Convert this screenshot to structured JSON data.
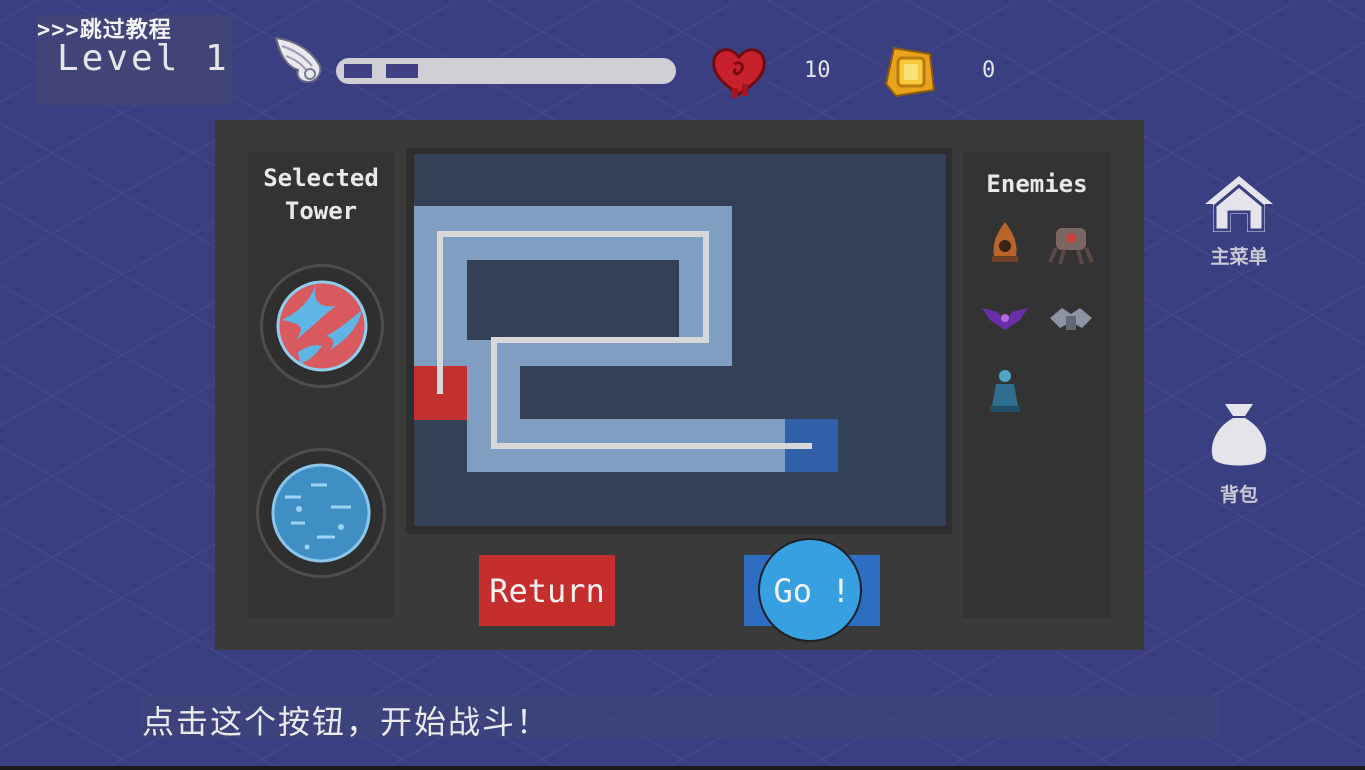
{
  "header": {
    "skip_tutorial": ">>>跳过教程",
    "level": "Level 1",
    "wave_progress": 0.24,
    "hp": "10",
    "gold": "0"
  },
  "menu": {
    "home_label": "主菜单",
    "bag_label": "背包"
  },
  "panel": {
    "selected_tower_label": "Selected Tower",
    "enemies_label": "Enemies",
    "return_label": "Return",
    "go_label": "Go !"
  },
  "hint": "点击这个按钮，开始战斗！",
  "colors": {
    "background": "#3a3f82",
    "panel": "#3a3a3a",
    "return": "#c62e2e",
    "go": "#2e6ec2",
    "path": "#7f9ec2",
    "start_tile": "#c23030",
    "end_tile": "#2f60a8"
  },
  "icons": {
    "wave": "wing-icon",
    "hp": "heart-icon",
    "gold": "coin-icon",
    "home": "home-icon",
    "bag": "bag-icon"
  }
}
